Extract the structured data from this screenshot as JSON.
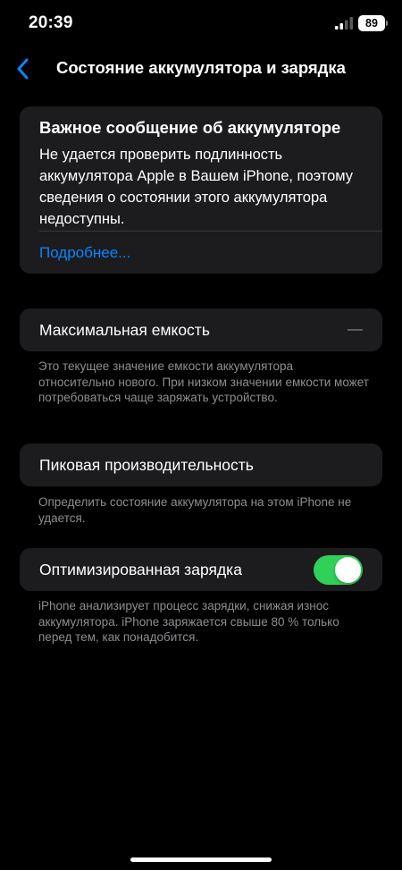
{
  "status_bar": {
    "time": "20:39",
    "battery_level": "89"
  },
  "nav": {
    "title": "Состояние аккумулятора и зарядка",
    "back_icon": "chevron-left-icon"
  },
  "alert": {
    "title": "Важное сообщение об аккумуляторе",
    "body": "Не удается проверить подлинность аккумулятора Apple в Вашем iPhone, поэтому сведения о состоянии этого аккумулятора недоступны.",
    "link": "Подробнее..."
  },
  "max_capacity": {
    "label": "Максимальная емкость",
    "value": "—",
    "footer": "Это текущее значение емкости аккумулятора относительно нового. При низком значении емкости может потребоваться чаще заряжать устройство."
  },
  "peak_performance": {
    "label": "Пиковая производительность",
    "footer": "Определить состояние аккумулятора на этом iPhone не удается."
  },
  "optimized_charging": {
    "label": "Оптимизированная зарядка",
    "enabled": true,
    "footer": "iPhone анализирует процесс зарядки, снижая износ аккумулятора. iPhone заряжается свыше 80 % только перед тем, как понадобится."
  },
  "colors": {
    "background": "#000000",
    "card": "#1c1c1e",
    "accent": "#0a84ff",
    "toggle_on": "#30d158",
    "secondary_text": "#8e8e93"
  }
}
